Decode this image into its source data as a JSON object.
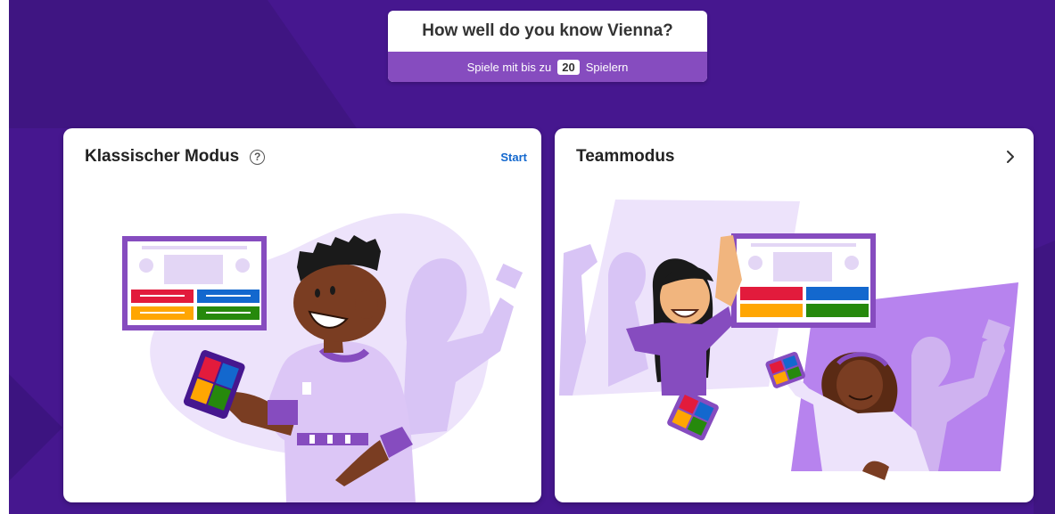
{
  "header": {
    "title": "How well do you know Vienna?",
    "subtitle_prefix": "Spiele mit bis zu",
    "player_count": "20",
    "subtitle_suffix": "Spielern"
  },
  "modes": {
    "classic": {
      "title": "Klassischer Modus",
      "action_label": "Start",
      "help_icon": "question-circle-icon"
    },
    "team": {
      "title": "Teammodus",
      "action_icon": "chevron-right-icon"
    }
  },
  "colors": {
    "background": "#46178f",
    "subtitle_bar": "#864cbf",
    "accent_link": "#1368ce",
    "answer_red": "#e21b3c",
    "answer_blue": "#1368ce",
    "answer_yellow": "#ffa602",
    "answer_green": "#26890c",
    "illustration_lilac": "#d8c4f5"
  }
}
